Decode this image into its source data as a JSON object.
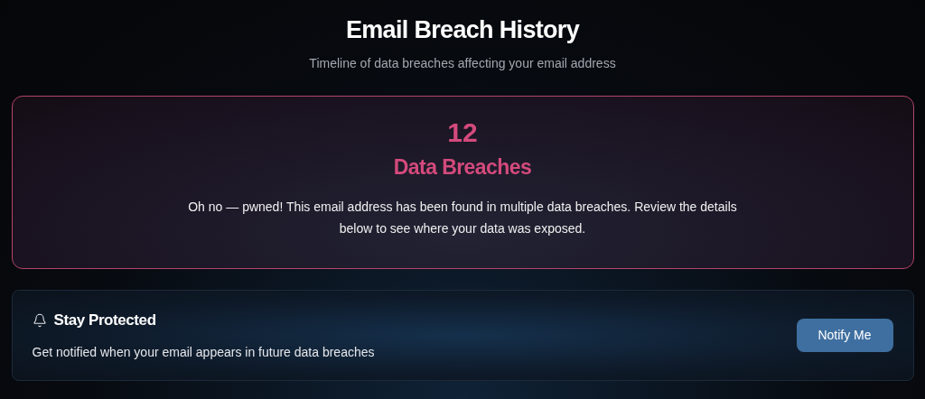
{
  "header": {
    "title": "Email Breach History",
    "subtitle": "Timeline of data breaches affecting your email address"
  },
  "summary": {
    "count": "12",
    "label": "Data Breaches",
    "message": "Oh no — pwned! This email address has been found in multiple data breaches. Review the details below to see where your data was exposed."
  },
  "notify": {
    "title": "Stay Protected",
    "description": "Get notified when your email appears in future data breaches",
    "button": "Notify Me"
  }
}
